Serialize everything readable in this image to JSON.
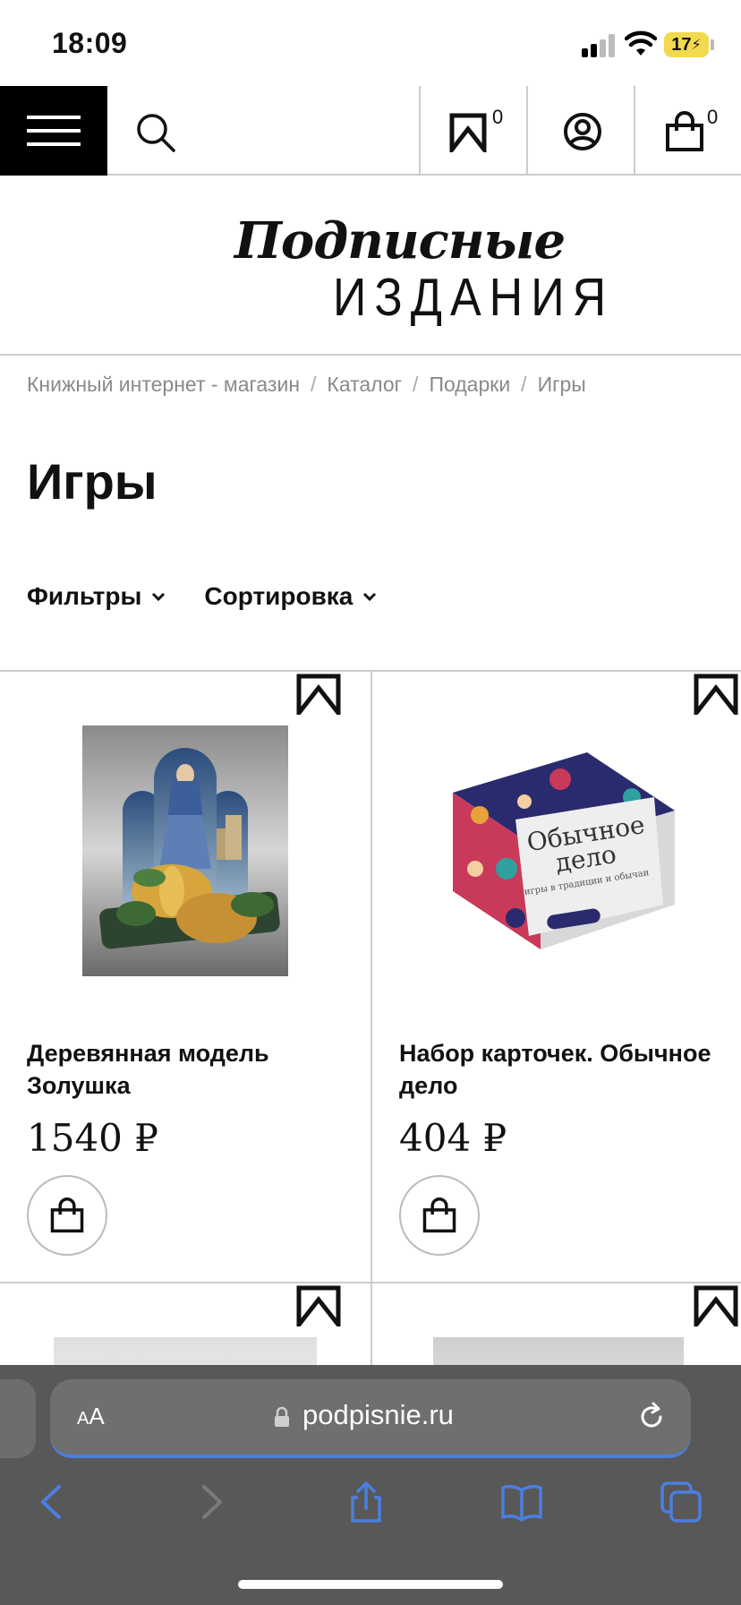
{
  "status_bar": {
    "time": "18:09",
    "battery": "17"
  },
  "header": {
    "bookmarks_count": "0",
    "cart_count": "0"
  },
  "logo": {
    "script_line": "Подписные",
    "caps_line": "ИЗДАНИЯ"
  },
  "breadcrumbs": [
    "Книжный интернет - магазин",
    "Каталог",
    "Подарки",
    "Игры"
  ],
  "breadcrumb_separator": "/",
  "page_title": "Игры",
  "toolbar": {
    "filters_label": "Фильтры",
    "sort_label": "Сортировка"
  },
  "products": [
    {
      "name": "Деревянная модель Золушка",
      "price": "1540 ₽"
    },
    {
      "name": "Набор карточек. Обычное дело",
      "price": "404 ₽"
    }
  ],
  "product_box_text": {
    "title_line1": "Обычное",
    "title_line2": "дело",
    "subtitle": "игры в традиции и обычаи"
  },
  "browser": {
    "text_size_label_small": "A",
    "text_size_label_large": "A",
    "url": "podpisnie.ru"
  },
  "colors": {
    "accent_blue": "#4a7fe0",
    "safari_bar": "#585858",
    "battery": "#f2d94e"
  }
}
